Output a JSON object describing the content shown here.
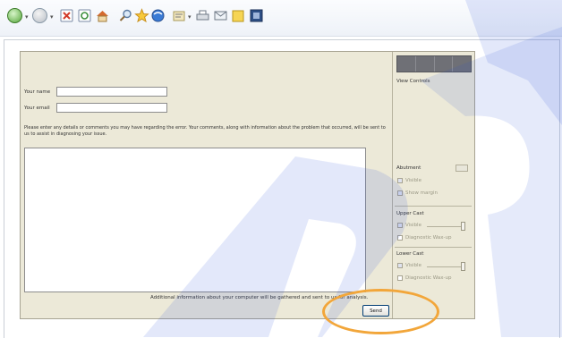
{
  "toolbar": {
    "icons": [
      "back-icon",
      "forward-icon",
      "stop-icon",
      "refresh-icon",
      "home-icon",
      "search-icon",
      "favorites-icon",
      "media-icon",
      "history-icon",
      "mail-icon",
      "print-icon",
      "edit-icon",
      "discuss-icon",
      "messenger-icon"
    ]
  },
  "form": {
    "name_label": "Your name",
    "email_label": "Your email",
    "name_value": "",
    "email_value": "",
    "instructions": "Please enter any details or comments you may have regarding the error. Your comments, along with information about the problem that occurred, will be sent to us to assist in diagnosing your issue.",
    "comments_value": "",
    "footer_note": "Additional information about your computer will be gathered and sent to us for analysis.",
    "send_label": "Send"
  },
  "panel": {
    "view_controls_label": "View Controls",
    "abutment_label": "Abutment",
    "abutment_visible_label": "Visible",
    "abutment_show_margin_label": "Show margin",
    "upper_cast_label": "Upper Cast",
    "upper_visible_label": "Visible",
    "upper_diagnostic_label": "Diagnostic Wax-up",
    "lower_cast_label": "Lower Cast",
    "lower_visible_label": "Visible",
    "lower_diagnostic_label": "Diagnostic Wax-up",
    "upper_slider_value": 1.0,
    "lower_slider_value": 1.0
  },
  "colors": {
    "dialog_bg": "#ece9d8",
    "highlight": "#f2a63a",
    "watermark": "#2a4fd6"
  }
}
